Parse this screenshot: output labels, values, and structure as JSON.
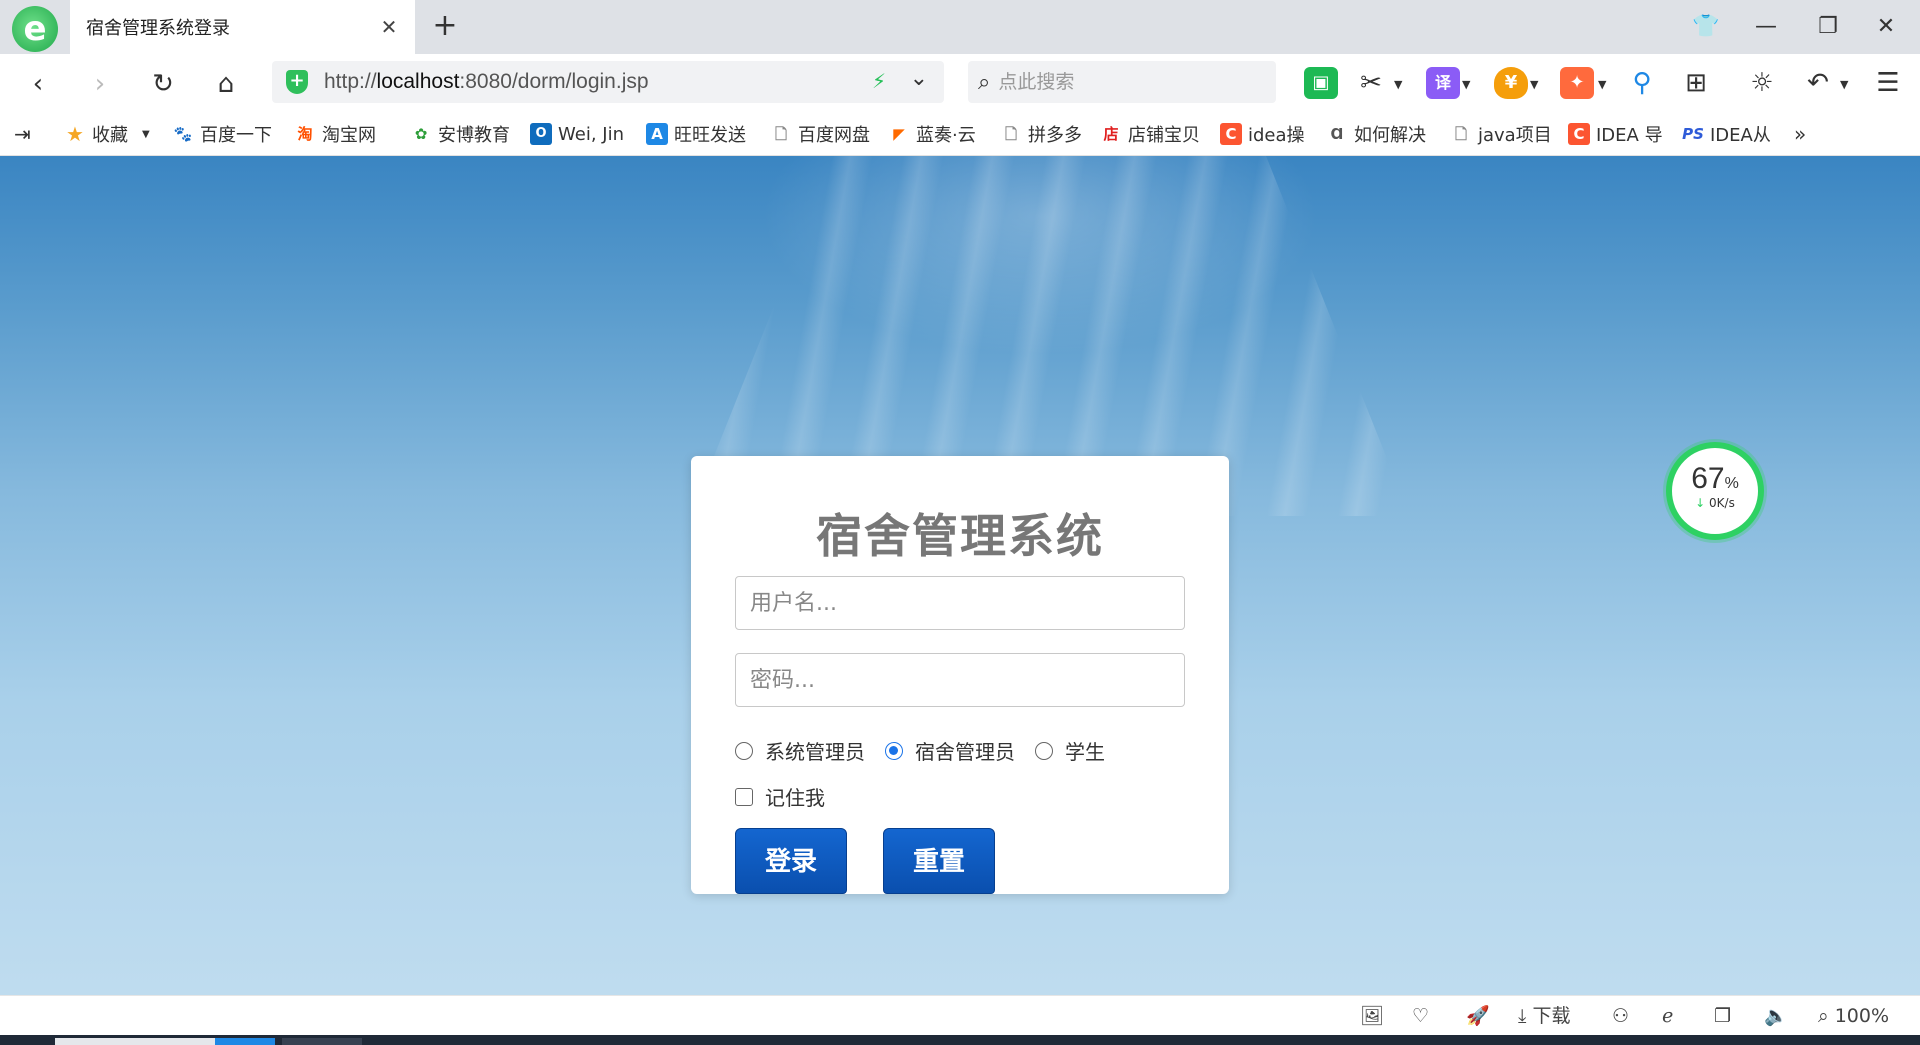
{
  "browser": {
    "tab_title": "宿舍管理系统登录",
    "url_protocol": "http://",
    "url_host": "localhost",
    "url_rest": ":8080/dorm/login.jsp",
    "search_placeholder": "点此搜索",
    "zoom": "100%",
    "download_label": "下载"
  },
  "bookmarks": [
    {
      "label": "收藏",
      "icon": "star-icon",
      "color": "#f5a623"
    },
    {
      "label": "百度一下",
      "icon": "baidu-paw-icon",
      "color": "#2932e1"
    },
    {
      "label": "淘宝网",
      "icon": "taobao-icon",
      "color": "#ff5000"
    },
    {
      "label": "安博教育",
      "icon": "gear-flower-icon",
      "color": "#2e9e3a"
    },
    {
      "label": "Wei, Jin",
      "icon": "outlook-icon",
      "color": "#0f6cbd"
    },
    {
      "label": "旺旺发送",
      "icon": "letter-a-icon",
      "color": "#1e88e5"
    },
    {
      "label": "百度网盘",
      "icon": "page-icon",
      "color": "#888888"
    },
    {
      "label": "蓝奏·云",
      "icon": "flag-icon",
      "color": "#ff6a00"
    },
    {
      "label": "拼多多",
      "icon": "page-icon",
      "color": "#888888"
    },
    {
      "label": "店铺宝贝",
      "icon": "shop-icon",
      "color": "#e02020"
    },
    {
      "label": "idea操",
      "icon": "csdn-icon",
      "color": "#fc5531"
    },
    {
      "label": "如何解决",
      "icon": "search-person-icon",
      "color": "#555555"
    },
    {
      "label": "java项目",
      "icon": "page-icon",
      "color": "#888888"
    },
    {
      "label": "IDEA 导",
      "icon": "csdn-icon",
      "color": "#fc5531"
    },
    {
      "label": "IDEA从",
      "icon": "ps-icon",
      "color": "#2e5bd8"
    }
  ],
  "login": {
    "title": "宿舍管理系统",
    "username_placeholder": "用户名...",
    "password_placeholder": "密码...",
    "roles": [
      {
        "label": "系统管理员",
        "selected": false
      },
      {
        "label": "宿舍管理员",
        "selected": true
      },
      {
        "label": "学生",
        "selected": false
      }
    ],
    "remember_label": "记住我",
    "remember_checked": false,
    "login_button": "登录",
    "reset_button": "重置"
  },
  "speed_widget": {
    "percent": "67",
    "percent_sign": "%",
    "rate": "0K/s"
  },
  "colors": {
    "accent": "#1a73e8",
    "button": "#0a4fae",
    "speed_ring": "#2ed163"
  }
}
